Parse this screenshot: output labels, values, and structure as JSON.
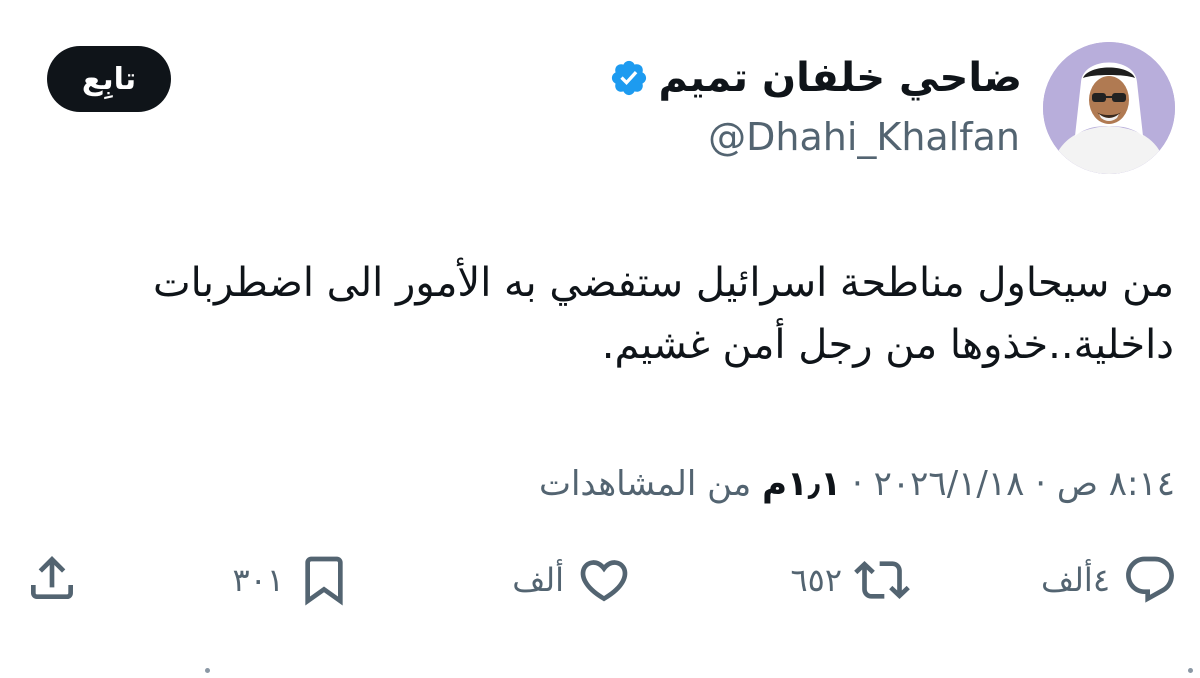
{
  "author": {
    "display_name": "ضاحي خلفان تميم",
    "handle": "@Dhahi_Khalfan",
    "verified": true,
    "verified_color": "#1d9bf0",
    "avatar_icon": "profile-photo"
  },
  "follow_label": "تابِع",
  "tweet": {
    "text": "من سيحاول مناطحة اسرائيل ستفضي به الأمور الى اضطربات داخلية..خذوها من رجل أمن غشيم."
  },
  "meta": {
    "time": "٨:١٤ ص",
    "date": "٢٠٢٦/١/١٨",
    "separator": "·",
    "views_count": "١٫١م",
    "views_label": "من المشاهدات"
  },
  "actions": {
    "reply": {
      "icon": "reply-icon",
      "count": "٤ألف"
    },
    "retweet": {
      "icon": "retweet-icon",
      "count": "٦٥٢"
    },
    "like": {
      "icon": "heart-icon",
      "count": "ألف"
    },
    "bookmark": {
      "icon": "bookmark-icon",
      "count": "٣٠١"
    },
    "share": {
      "icon": "share-icon"
    }
  },
  "colors": {
    "text_primary": "#0f1419",
    "text_secondary": "#536471",
    "button_bg": "#0f1419",
    "button_text": "#ffffff"
  }
}
